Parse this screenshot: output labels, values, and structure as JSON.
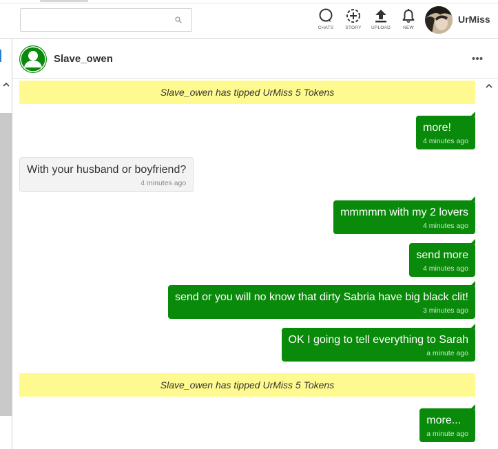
{
  "header": {
    "search": {
      "placeholder": "",
      "value": ""
    },
    "nav": [
      {
        "label": "CHATS",
        "icon": "chat-bubble-icon"
      },
      {
        "label": "STORY",
        "icon": "story-plus-icon"
      },
      {
        "label": "UPLOAD",
        "icon": "upload-arrow-icon"
      },
      {
        "label": "NEW",
        "icon": "bell-icon"
      }
    ],
    "user": {
      "name": "UrMiss"
    }
  },
  "chat": {
    "contact": "Slave_owen",
    "items": [
      {
        "kind": "tip",
        "text": "Slave_owen has tipped UrMiss 5 Tokens"
      },
      {
        "kind": "sent",
        "text": "more!",
        "time": "4 minutes ago"
      },
      {
        "kind": "recv",
        "text": "With your husband or boyfriend?",
        "time": "4 minutes ago"
      },
      {
        "kind": "sent",
        "text": "mmmmm with my 2 lovers",
        "time": "4 minutes ago"
      },
      {
        "kind": "sent",
        "text": "send more",
        "time": "4 minutes ago"
      },
      {
        "kind": "sent",
        "text": "send or you will no know that dirty Sabria have big black clit!",
        "time": "3 minutes ago"
      },
      {
        "kind": "sent",
        "text": "OK I going to tell everything to Sarah",
        "time": "a minute ago"
      },
      {
        "kind": "tip",
        "text": "Slave_owen has tipped UrMiss 5 Tokens"
      },
      {
        "kind": "sent",
        "text": "more...",
        "time": "a minute ago"
      }
    ]
  },
  "colors": {
    "sent": "#0a8a0a",
    "tip": "#fffa8f",
    "received": "#f3f3f3"
  }
}
